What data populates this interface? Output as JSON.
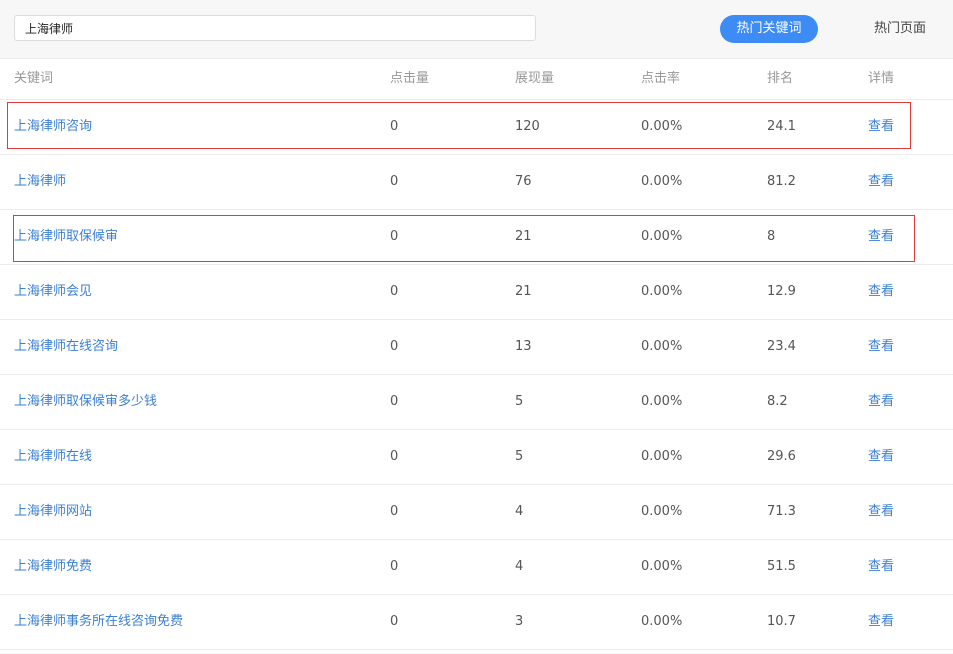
{
  "search": {
    "value": "上海律师"
  },
  "tabs": {
    "hot_keywords": "热门关键词",
    "hot_pages": "热门页面"
  },
  "columns": {
    "keyword": "关键词",
    "clicks": "点击量",
    "impressions": "展现量",
    "ctr": "点击率",
    "rank": "排名",
    "detail": "详情"
  },
  "rows": [
    {
      "keyword": "上海律师咨询",
      "clicks": "0",
      "impressions": "120",
      "ctr": "0.00%",
      "rank": "24.1",
      "detail": "查看",
      "highlighted": true
    },
    {
      "keyword": "上海律师",
      "clicks": "0",
      "impressions": "76",
      "ctr": "0.00%",
      "rank": "81.2",
      "detail": "查看",
      "highlighted": false
    },
    {
      "keyword": "上海律师取保候审",
      "clicks": "0",
      "impressions": "21",
      "ctr": "0.00%",
      "rank": "8",
      "detail": "查看",
      "highlighted": true
    },
    {
      "keyword": "上海律师会见",
      "clicks": "0",
      "impressions": "21",
      "ctr": "0.00%",
      "rank": "12.9",
      "detail": "查看",
      "highlighted": false
    },
    {
      "keyword": "上海律师在线咨询",
      "clicks": "0",
      "impressions": "13",
      "ctr": "0.00%",
      "rank": "23.4",
      "detail": "查看",
      "highlighted": false
    },
    {
      "keyword": "上海律师取保候审多少钱",
      "clicks": "0",
      "impressions": "5",
      "ctr": "0.00%",
      "rank": "8.2",
      "detail": "查看",
      "highlighted": false
    },
    {
      "keyword": "上海律师在线",
      "clicks": "0",
      "impressions": "5",
      "ctr": "0.00%",
      "rank": "29.6",
      "detail": "查看",
      "highlighted": false
    },
    {
      "keyword": "上海律师网站",
      "clicks": "0",
      "impressions": "4",
      "ctr": "0.00%",
      "rank": "71.3",
      "detail": "查看",
      "highlighted": false
    },
    {
      "keyword": "上海律师免费",
      "clicks": "0",
      "impressions": "4",
      "ctr": "0.00%",
      "rank": "51.5",
      "detail": "查看",
      "highlighted": false
    },
    {
      "keyword": "上海律师事务所在线咨询免费",
      "clicks": "0",
      "impressions": "3",
      "ctr": "0.00%",
      "rank": "10.7",
      "detail": "查看",
      "highlighted": false
    }
  ],
  "colors": {
    "accent": "#3d8cf5",
    "link": "#3a7fd5",
    "highlight_border": "#e03a3a"
  }
}
